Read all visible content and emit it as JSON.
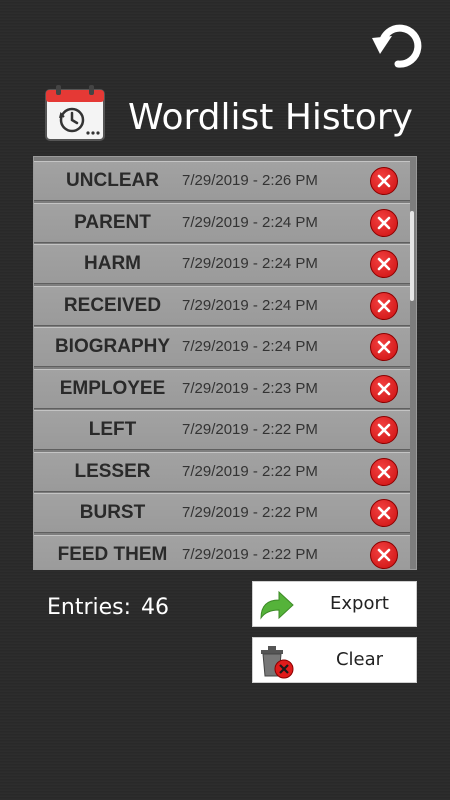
{
  "header": {
    "title": "Wordlist History",
    "back_icon": "undo-arrow-icon",
    "title_icon": "calendar-history-icon"
  },
  "history": [
    {
      "word": "UNCLEAR",
      "date": "7/29/2019 - 2:26 PM"
    },
    {
      "word": "PARENT",
      "date": "7/29/2019 - 2:24 PM"
    },
    {
      "word": "HARM",
      "date": "7/29/2019 - 2:24 PM"
    },
    {
      "word": "RECEIVED",
      "date": "7/29/2019 - 2:24 PM"
    },
    {
      "word": "BIOGRAPHY",
      "date": "7/29/2019 - 2:24 PM"
    },
    {
      "word": "EMPLOYEE",
      "date": "7/29/2019 - 2:23 PM"
    },
    {
      "word": "LEFT",
      "date": "7/29/2019 - 2:22 PM"
    },
    {
      "word": "LESSER",
      "date": "7/29/2019 - 2:22 PM"
    },
    {
      "word": "BURST",
      "date": "7/29/2019 - 2:22 PM"
    },
    {
      "word": "FEED THEM",
      "date": "7/29/2019 - 2:22 PM"
    }
  ],
  "footer": {
    "entries_label": "Entries:",
    "entries_value": "46",
    "export_label": "Export",
    "clear_label": "Clear"
  },
  "colors": {
    "delete_red": "#e01b1b",
    "export_green": "#4caf50",
    "background": "#2b2b2b"
  }
}
